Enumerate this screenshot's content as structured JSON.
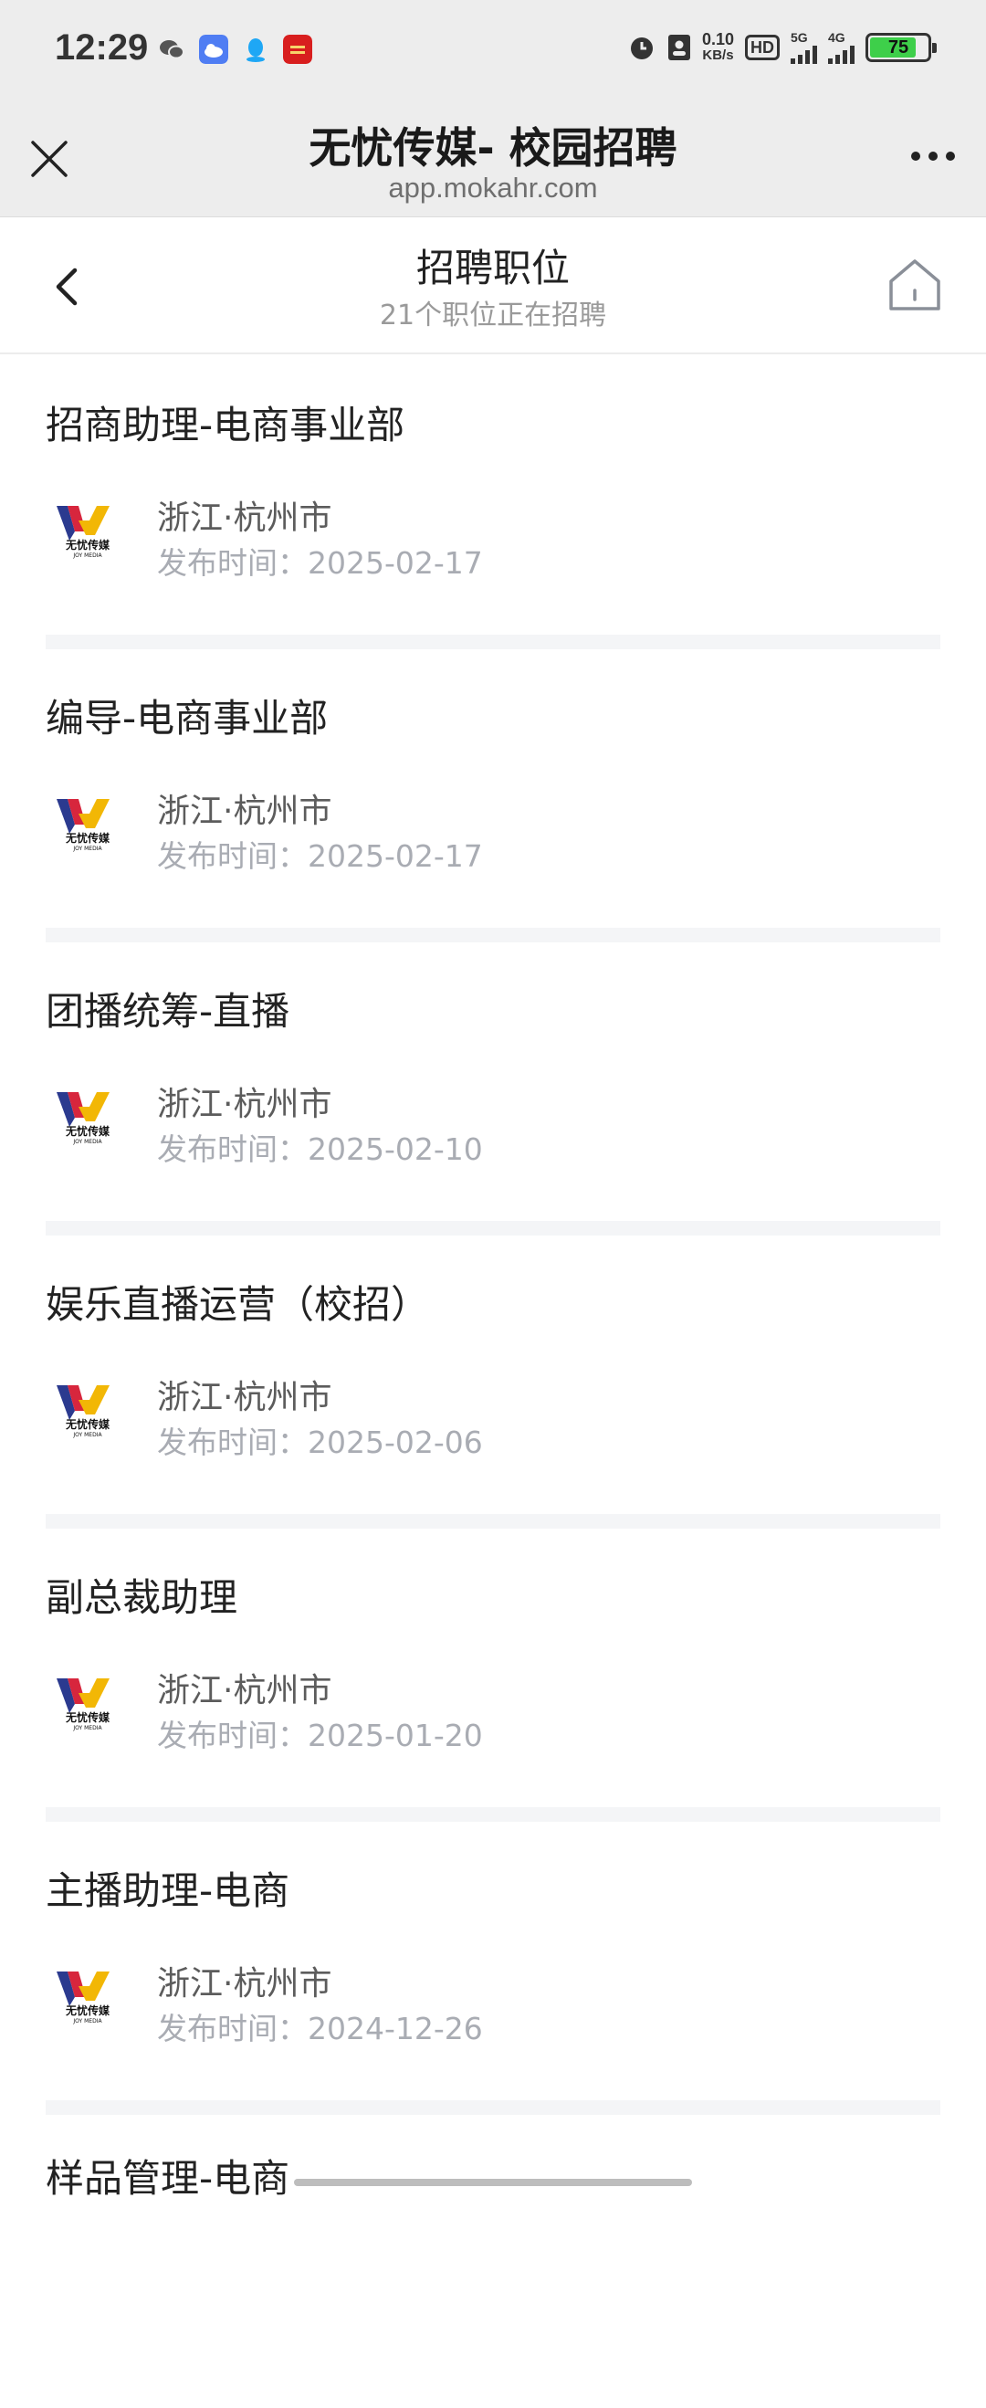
{
  "status_bar": {
    "time": "12:29",
    "net_speed": "0.10",
    "net_unit": "KB/s",
    "hd": "HD",
    "net1": "5G",
    "net2": "4G",
    "battery": "75"
  },
  "browser": {
    "title": "无忧传媒- 校园招聘",
    "url": "app.mokahr.com"
  },
  "header": {
    "title": "招聘职位",
    "subtitle": "21个职位正在招聘"
  },
  "jobs": [
    {
      "title": "招商助理-电商事业部",
      "location": "浙江·杭州市",
      "date": "发布时间：2025-02-17"
    },
    {
      "title": "编导-电商事业部",
      "location": "浙江·杭州市",
      "date": "发布时间：2025-02-17"
    },
    {
      "title": "团播统筹-直播",
      "location": "浙江·杭州市",
      "date": "发布时间：2025-02-10"
    },
    {
      "title": "娱乐直播运营（校招）",
      "location": "浙江·杭州市",
      "date": "发布时间：2025-02-06"
    },
    {
      "title": "副总裁助理",
      "location": "浙江·杭州市",
      "date": "发布时间：2025-01-20"
    },
    {
      "title": "主播助理-电商",
      "location": "浙江·杭州市",
      "date": "发布时间：2024-12-26"
    },
    {
      "title": "样品管理-电商",
      "location": "",
      "date": ""
    }
  ],
  "logo_text": "无忧传媒",
  "logo_sub": "JOY MEDIA",
  "colors": {
    "battery": "#3ecf4a",
    "logo_blue": "#2b3a8f",
    "logo_red": "#d7263d",
    "logo_yellow": "#f2b705"
  }
}
